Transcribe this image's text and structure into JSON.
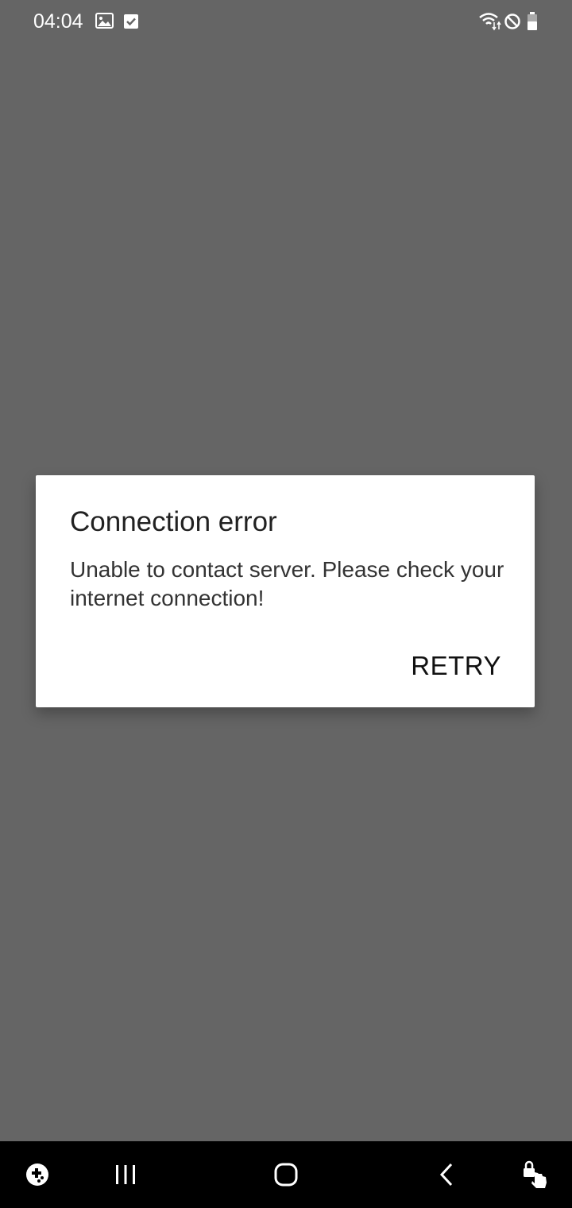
{
  "status_bar": {
    "time": "04:04",
    "icons": [
      "image-icon",
      "checkbox-icon",
      "wifi-icon",
      "no-sim-icon",
      "battery-icon"
    ]
  },
  "dialog": {
    "title": "Connection error",
    "message": "Unable to contact server. Please check your internet connection!",
    "retry_label": "RETRY"
  },
  "navigation_bar": {
    "buttons": [
      "game-tools-icon",
      "recents-icon",
      "home-icon",
      "back-icon",
      "accessibility-icon"
    ]
  },
  "colors": {
    "scrim": "#656565",
    "dialog_background": "#ffffff",
    "navigation_background": "#000000"
  }
}
